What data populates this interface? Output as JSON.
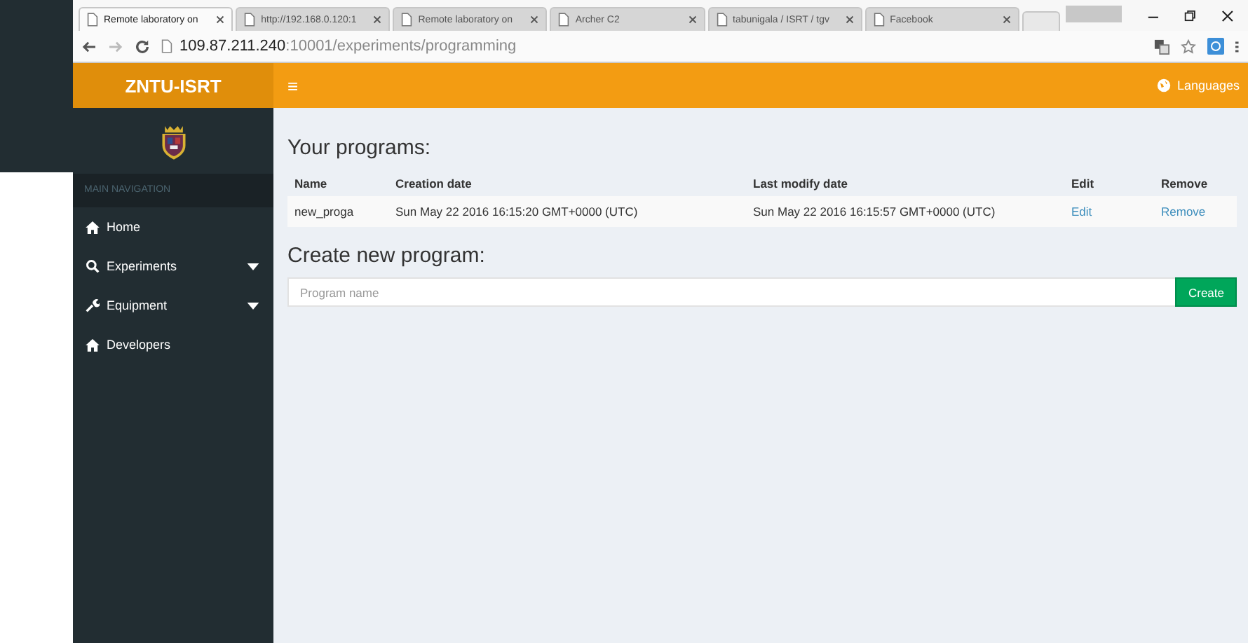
{
  "browser": {
    "tabs": [
      {
        "title": "Remote laboratory on",
        "selected": true
      },
      {
        "title": "http://192.168.0.120:1",
        "selected": false
      },
      {
        "title": "Remote laboratory on",
        "selected": false
      },
      {
        "title": "Archer C2",
        "selected": false
      },
      {
        "title": "tabunigala / ISRT / tgv",
        "selected": false
      },
      {
        "title": "Facebook",
        "selected": false
      }
    ],
    "address": {
      "host": "109.87.211.240",
      "path": ":10001/experiments/programming"
    }
  },
  "app": {
    "brand": "ZNTU-ISRT",
    "menu_toggle": "≡",
    "languages": "Languages"
  },
  "sidebar": {
    "section": "MAIN NAVIGATION",
    "items": [
      {
        "label": "Home",
        "expandable": false
      },
      {
        "label": "Experiments",
        "expandable": true
      },
      {
        "label": "Equipment",
        "expandable": true
      },
      {
        "label": "Developers",
        "expandable": false
      }
    ]
  },
  "programs": {
    "title": "Your programs:",
    "columns": [
      "Name",
      "Creation date",
      "Last modify date",
      "Edit",
      "Remove"
    ],
    "rows": [
      {
        "name": "new_proga",
        "created": "Sun May 22 2016 16:15:20 GMT+0000 (UTC)",
        "modified": "Sun May 22 2016 16:15:57 GMT+0000 (UTC)",
        "edit": "Edit",
        "remove": "Remove"
      }
    ]
  },
  "create": {
    "title": "Create new program:",
    "placeholder": "Program name",
    "button": "Create"
  }
}
